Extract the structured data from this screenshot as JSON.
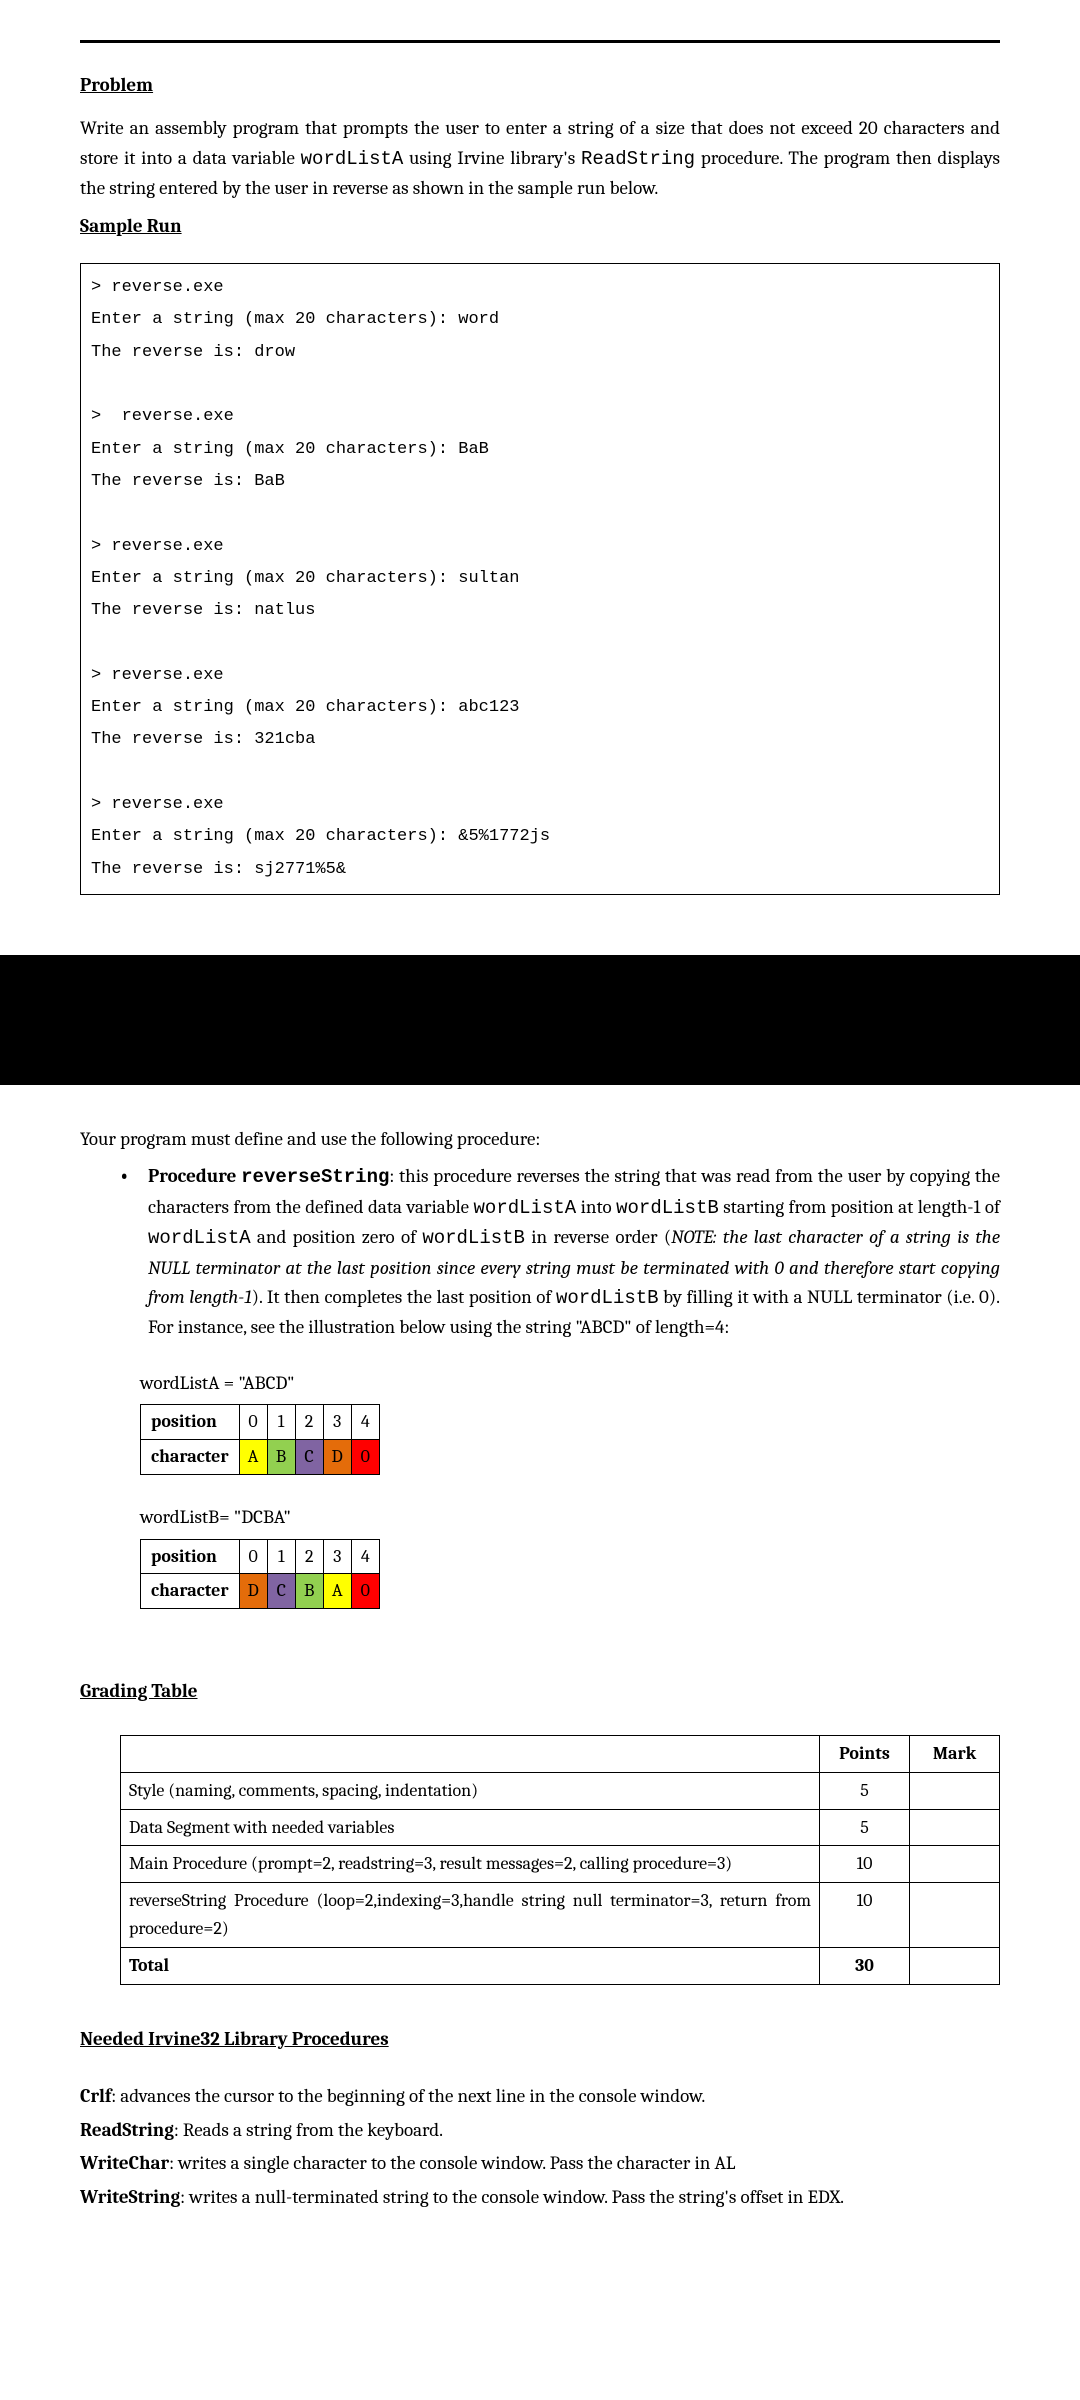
{
  "page1": {
    "heading_problem": "Problem",
    "problem_p1a": "Write an assembly program that prompts the user to enter a string of a size that does not exceed 20 characters and store it into a data variable ",
    "problem_wordListA": "wordListA",
    "problem_p1b": " using Irvine library's ",
    "problem_readstring": "ReadString",
    "problem_p1c": " procedure. The program then displays the string entered by the user in reverse as shown in the sample run below.",
    "heading_sample": "Sample Run ",
    "sample": "> reverse.exe\nEnter a string (max 20 characters): word\nThe reverse is: drow\n\n>  reverse.exe\nEnter a string (max 20 characters): BaB\nThe reverse is: BaB\n\n> reverse.exe\nEnter a string (max 20 characters): sultan\nThe reverse is: natlus\n\n> reverse.exe\nEnter a string (max 20 characters): abc123\nThe reverse is: 321cba\n\n> reverse.exe\nEnter a string (max 20 characters): &5%1772js\nThe reverse is: sj2771%5&"
  },
  "page2": {
    "intro": "Your program must define and use the following procedure:",
    "bullet_lead_a": "Procedure ",
    "bullet_lead_b": "reverseString",
    "bullet_lead_c": ": this procedure reverses the string that was read from the user by copying the characters from the defined data variable ",
    "bullet_wordA": "wordListA",
    "bullet_into": " into ",
    "bullet_wordB": "wordListB",
    "bullet_d": " starting from position at length-1 of ",
    "bullet_e": " and position zero of ",
    "bullet_f": " in reverse order (",
    "bullet_note": "NOTE: the last character of a string is the NULL terminator at the last position since every string must be terminated with 0 and therefore start copying from length-1",
    "bullet_g": "). It then completes the last position of ",
    "bullet_h": " by filling it with a NULL terminator (i.e. 0). For instance, see the illustration below using the string \"ABCD\" of length=4:",
    "tableA": {
      "caption": "wordListA = \"ABCD\"",
      "row1_label": "position",
      "row2_label": "character",
      "positions": [
        "0",
        "1",
        "2",
        "3",
        "4"
      ],
      "chars": [
        "A",
        "B",
        "C",
        "D",
        "0"
      ]
    },
    "tableB": {
      "caption": "wordListB= \"DCBA\"",
      "row1_label": "position",
      "row2_label": "character",
      "positions": [
        "0",
        "1",
        "2",
        "3",
        "4"
      ],
      "chars": [
        "D",
        "C",
        "B",
        "A",
        "0"
      ]
    },
    "heading_grading": "Grading Table",
    "grading": {
      "head_points": "Points",
      "head_mark": "Mark",
      "rows": [
        {
          "desc": "Style (naming, comments, spacing, indentation)",
          "pts": "5"
        },
        {
          "desc": "Data Segment with needed variables",
          "pts": "5"
        },
        {
          "desc": "Main Procedure (prompt=2, readstring=3, result messages=2, calling procedure=3)",
          "pts": "10"
        },
        {
          "desc": "reverseString Procedure (loop=2,indexing=3,handle string null terminator=3, return from procedure=2)",
          "pts": "10"
        }
      ],
      "total_label": "Total",
      "total_pts": "30"
    },
    "heading_lib": "Needed Irvine32 Library Procedures",
    "lib": {
      "crlf_name": "Crlf",
      "crlf_desc": ": advances the cursor to the beginning of the next line in the console window.",
      "read_name": "ReadString",
      "read_desc": ": Reads a string from the keyboard.",
      "wchar_name": "WriteChar",
      "wchar_desc": ": writes a single character to the console window. Pass the character in AL",
      "wstr_name": "WriteString",
      "wstr_desc": ": writes a null-terminated string to the console window. Pass the string's offset in EDX."
    }
  }
}
